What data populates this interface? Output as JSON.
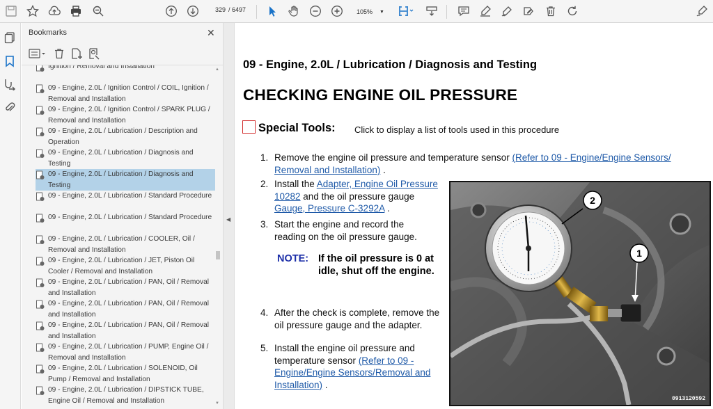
{
  "toolbar": {
    "page_current": "329",
    "page_total": "/ 6497",
    "zoom": "105%",
    "icons": [
      "save-icon",
      "bookmark-star-icon",
      "upload-icon",
      "print-icon",
      "zoom-out-search-icon",
      "prev-page-icon",
      "next-page-icon",
      "select-cursor-icon",
      "hand-icon",
      "zoom-out-icon",
      "zoom-in-icon",
      "fit-width-icon",
      "scroll-mode-icon",
      "comment-icon",
      "highlight-icon",
      "draw-icon",
      "sign-icon",
      "delete-icon",
      "rotate-icon",
      "share-icon"
    ]
  },
  "sidebar": {
    "rail_icons": [
      "pages-icon",
      "bookmarks-icon",
      "signatures-icon",
      "attachments-icon"
    ],
    "title": "Bookmarks",
    "items": [
      {
        "label": "Ignition / Removal and Installation"
      },
      {
        "label": "09 - Engine, 2.0L / Ignition Control / COIL, Ignition / Removal and Installation"
      },
      {
        "label": "09 - Engine, 2.0L / Ignition Control / SPARK PLUG / Removal and Installation"
      },
      {
        "label": "09 - Engine, 2.0L / Lubrication / Description and Operation"
      },
      {
        "label": "09 - Engine, 2.0L / Lubrication / Diagnosis and Testing"
      },
      {
        "label": "09 - Engine, 2.0L / Lubrication / Diagnosis and Testing"
      },
      {
        "label": "09 - Engine, 2.0L / Lubrication / Standard Procedure"
      },
      {
        "label": "09 - Engine, 2.0L / Lubrication / Standard Procedure"
      },
      {
        "label": "09 - Engine, 2.0L / Lubrication / COOLER, Oil / Removal and Installation"
      },
      {
        "label": "09 - Engine, 2.0L / Lubrication / JET, Piston Oil Cooler / Removal and Installation"
      },
      {
        "label": "09 - Engine, 2.0L / Lubrication / PAN, Oil / Removal and Installation"
      },
      {
        "label": "09 - Engine, 2.0L / Lubrication / PAN, Oil / Removal and Installation"
      },
      {
        "label": "09 - Engine, 2.0L / Lubrication / PAN, Oil / Removal and Installation"
      },
      {
        "label": "09 - Engine, 2.0L / Lubrication / PUMP, Engine Oil / Removal and Installation"
      },
      {
        "label": "09 - Engine, 2.0L / Lubrication / SOLENOID, Oil Pump / Removal and Installation"
      },
      {
        "label": "09 - Engine, 2.0L / Lubrication / DIPSTICK TUBE, Engine Oil / Removal and Installation"
      }
    ]
  },
  "document": {
    "section_heading": "09 - Engine, 2.0L / Lubrication / Diagnosis and Testing",
    "main_heading": "CHECKING ENGINE OIL PRESSURE",
    "special_tools_label": "Special Tools:",
    "special_tools_desc": "Click to display a list of tools used in this procedure",
    "steps": [
      {
        "num": "1.",
        "pre": "Remove the engine oil pressure and temperature sensor ",
        "link": "(Refer to 09 - Engine/Engine Sensors/ Removal and Installation)",
        "post": " ."
      },
      {
        "num": "2.",
        "pre": "Install the ",
        "link": "Adapter, Engine Oil Pressure 10282",
        "mid": " and the oil pressure gauge ",
        "link2": "Gauge, Pressure C-3292A",
        "post": " ."
      },
      {
        "num": "3.",
        "pre": "Start the engine and record the reading on the oil pressure gauge."
      },
      {
        "num": "4.",
        "pre": "After the check is complete, remove the oil pressure gauge and the adapter."
      },
      {
        "num": "5.",
        "pre": "Install the engine oil pressure and temperature sensor ",
        "link": "(Refer to 09 - Engine/Engine Sensors/Removal and Installation)",
        "post": " ."
      }
    ],
    "note_label": "NOTE:",
    "note_text": "If the oil pressure is 0 at idle, shut off the engine.",
    "photo": {
      "callout_1": "1",
      "callout_2": "2",
      "image_id": "0913120592"
    }
  }
}
